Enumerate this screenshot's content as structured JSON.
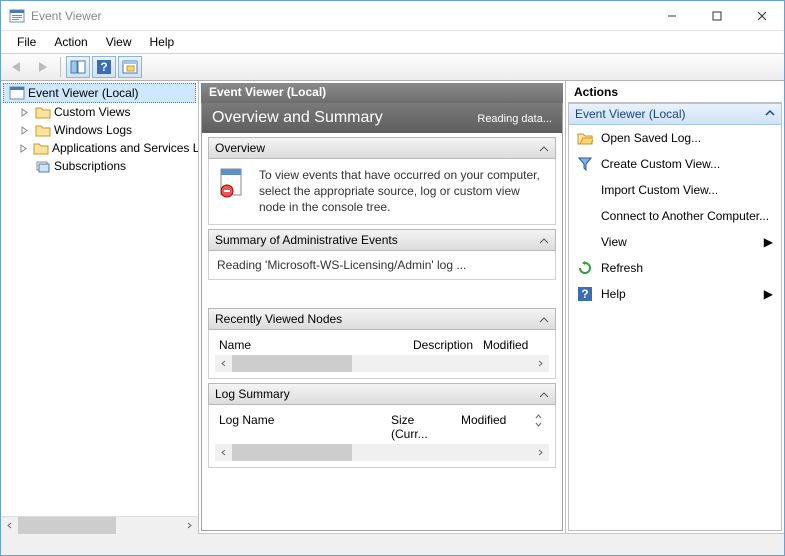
{
  "window": {
    "title": "Event Viewer"
  },
  "menu": {
    "items": [
      "File",
      "Action",
      "View",
      "Help"
    ]
  },
  "tree": {
    "root": "Event Viewer (Local)",
    "nodes": [
      {
        "label": "Custom Views"
      },
      {
        "label": "Windows Logs"
      },
      {
        "label": "Applications and Services Logs"
      },
      {
        "label": "Subscriptions"
      }
    ]
  },
  "center": {
    "header": "Event Viewer (Local)",
    "title": "Overview and Summary",
    "status": "Reading data...",
    "sections": {
      "overview": {
        "header": "Overview",
        "text": "To view events that have occurred on your computer, select the appropriate source, log or custom view node in the console tree."
      },
      "summary": {
        "header": "Summary of Administrative Events",
        "text": "Reading 'Microsoft-WS-Licensing/Admin' log ..."
      },
      "recent": {
        "header": "Recently Viewed Nodes",
        "cols": [
          "Name",
          "Description",
          "Modified"
        ]
      },
      "logsummary": {
        "header": "Log Summary",
        "cols": [
          "Log Name",
          "Size (Curr...",
          "Modified"
        ]
      }
    }
  },
  "actions": {
    "header": "Actions",
    "group": "Event Viewer (Local)",
    "items": [
      {
        "icon": "open",
        "label": "Open Saved Log..."
      },
      {
        "icon": "funnel",
        "label": "Create Custom View..."
      },
      {
        "icon": "blank",
        "label": "Import Custom View..."
      },
      {
        "icon": "blank",
        "label": "Connect to Another Computer..."
      },
      {
        "icon": "blank",
        "label": "View",
        "arrow": true
      },
      {
        "icon": "refresh",
        "label": "Refresh"
      },
      {
        "icon": "help",
        "label": "Help",
        "arrow": true
      }
    ]
  }
}
